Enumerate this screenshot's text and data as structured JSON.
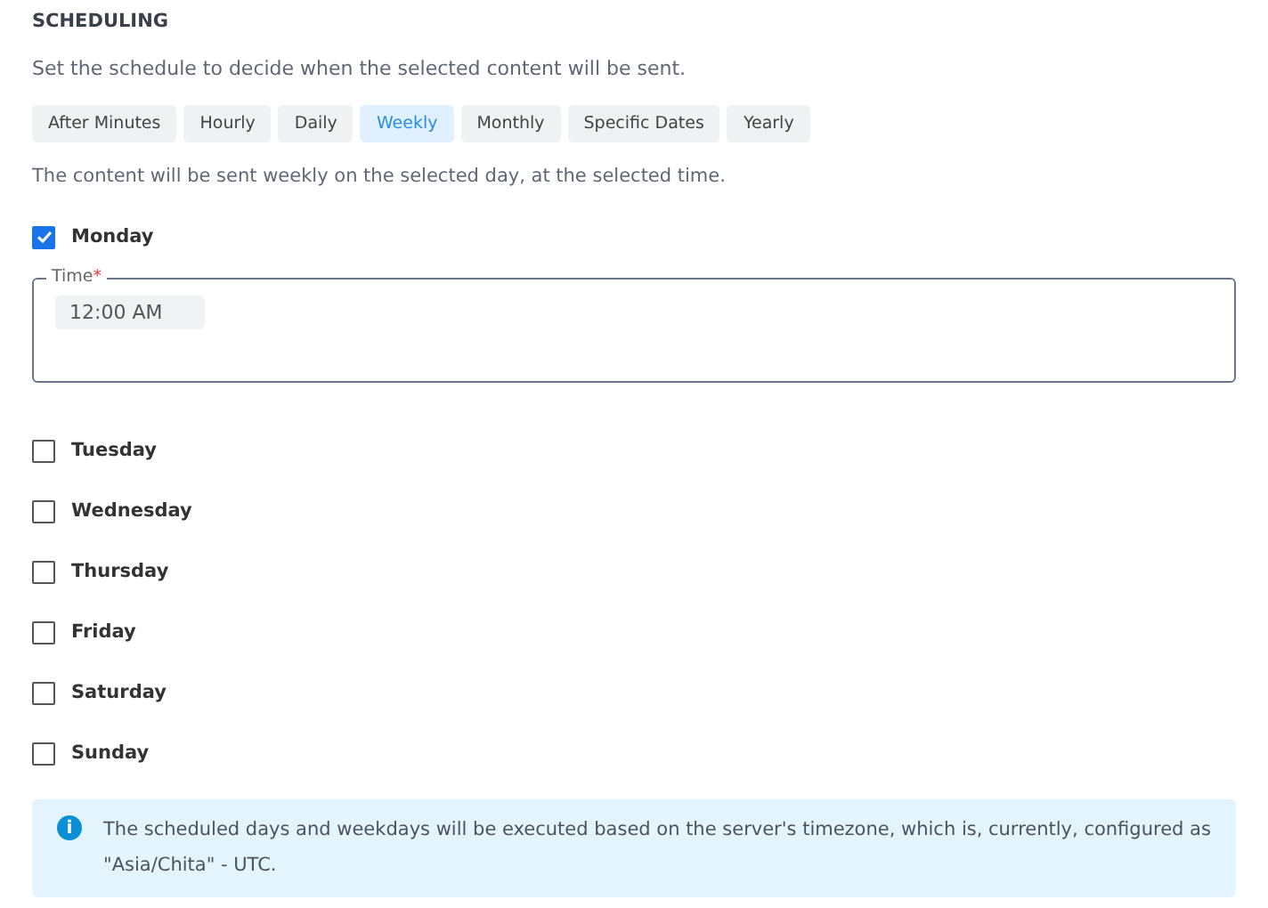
{
  "title": "SCHEDULING",
  "description": "Set the schedule to decide when the selected content will be sent.",
  "tabs": [
    {
      "label": "After Minutes",
      "selected": false
    },
    {
      "label": "Hourly",
      "selected": false
    },
    {
      "label": "Daily",
      "selected": false
    },
    {
      "label": "Weekly",
      "selected": true
    },
    {
      "label": "Monthly",
      "selected": false
    },
    {
      "label": "Specific Dates",
      "selected": false
    },
    {
      "label": "Yearly",
      "selected": false
    }
  ],
  "mode_description": "The content will be sent weekly on the selected day, at the selected time.",
  "days": [
    {
      "label": "Monday",
      "checked": true,
      "time": {
        "label": "Time",
        "required_mark": "*",
        "value": "12:00 AM"
      }
    },
    {
      "label": "Tuesday",
      "checked": false
    },
    {
      "label": "Wednesday",
      "checked": false
    },
    {
      "label": "Thursday",
      "checked": false
    },
    {
      "label": "Friday",
      "checked": false
    },
    {
      "label": "Saturday",
      "checked": false
    },
    {
      "label": "Sunday",
      "checked": false
    }
  ],
  "info": {
    "icon": "i",
    "text": "The scheduled days and weekdays will be executed based on the server's timezone, which is, currently, configured as \"Asia/Chita\" - UTC."
  }
}
